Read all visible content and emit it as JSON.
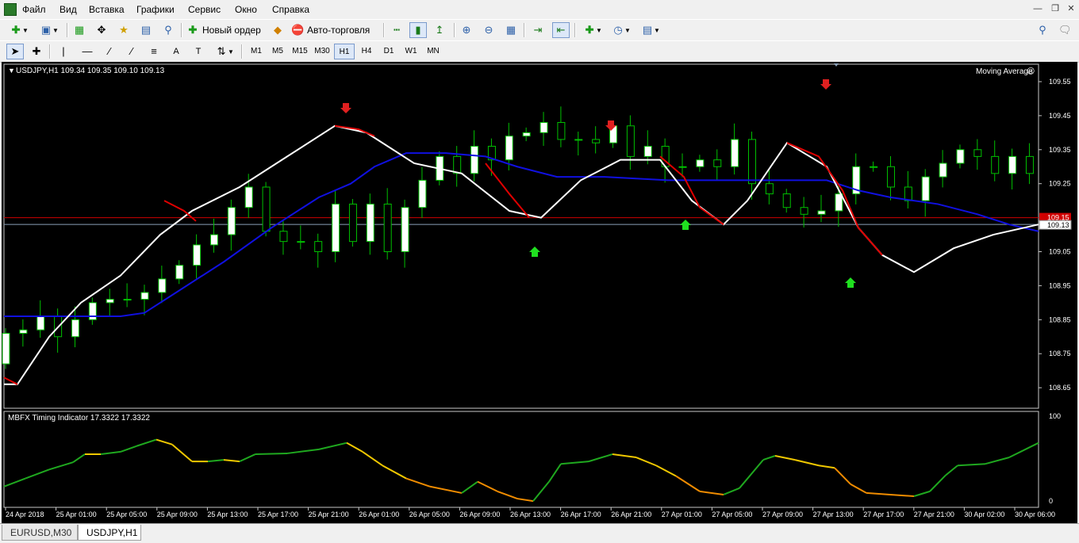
{
  "menu": [
    "Файл",
    "Вид",
    "Вставка",
    "Графики",
    "Сервис",
    "Окно",
    "Справка"
  ],
  "toolbar": {
    "new_order": "Новый ордер",
    "auto_trading": "Авто-торговля"
  },
  "timeframes": [
    "M1",
    "M5",
    "M15",
    "M30",
    "H1",
    "H4",
    "D1",
    "W1",
    "MN"
  ],
  "active_timeframe": "H1",
  "chart": {
    "header": "USDJPY,H1  109.34 109.35 109.10 109.13",
    "indicator_label": "Moving Average",
    "subwindow_label": "MBFX Timing Indicator 17.3322 17.3322",
    "price_labels": [
      "109.55",
      "109.45",
      "109.35",
      "109.25",
      "109.05",
      "108.95",
      "108.85",
      "108.75",
      "108.65"
    ],
    "red_line_label": "109.15",
    "current_price_label": "109.13",
    "sub_scale": [
      "100",
      "0"
    ],
    "time_labels": [
      "24 Apr 2018",
      "25 Apr 01:00",
      "25 Apr 05:00",
      "25 Apr 09:00",
      "25 Apr 13:00",
      "25 Apr 17:00",
      "25 Apr 21:00",
      "26 Apr 01:00",
      "26 Apr 05:00",
      "26 Apr 09:00",
      "26 Apr 13:00",
      "26 Apr 17:00",
      "26 Apr 21:00",
      "27 Apr 01:00",
      "27 Apr 05:00",
      "27 Apr 09:00",
      "27 Apr 13:00",
      "27 Apr 17:00",
      "27 Apr 21:00",
      "30 Apr 02:00",
      "30 Apr 06:00"
    ],
    "colors": {
      "bull_candle": "#ffffff",
      "bear_candle": "#000000",
      "wick": "#00c000",
      "ma_blue": "#1010e0",
      "ma_white": "#ffffff",
      "ma_red": "#e00000",
      "bid_line": "#8aa0b8",
      "level_line": "#d00000",
      "osc_green": "#1fa81f",
      "osc_yellow": "#f0c800",
      "osc_orange": "#f08c00"
    }
  },
  "tabs": [
    "EURUSD,M30",
    "USDJPY,H1"
  ],
  "active_tab": "USDJPY,H1"
}
